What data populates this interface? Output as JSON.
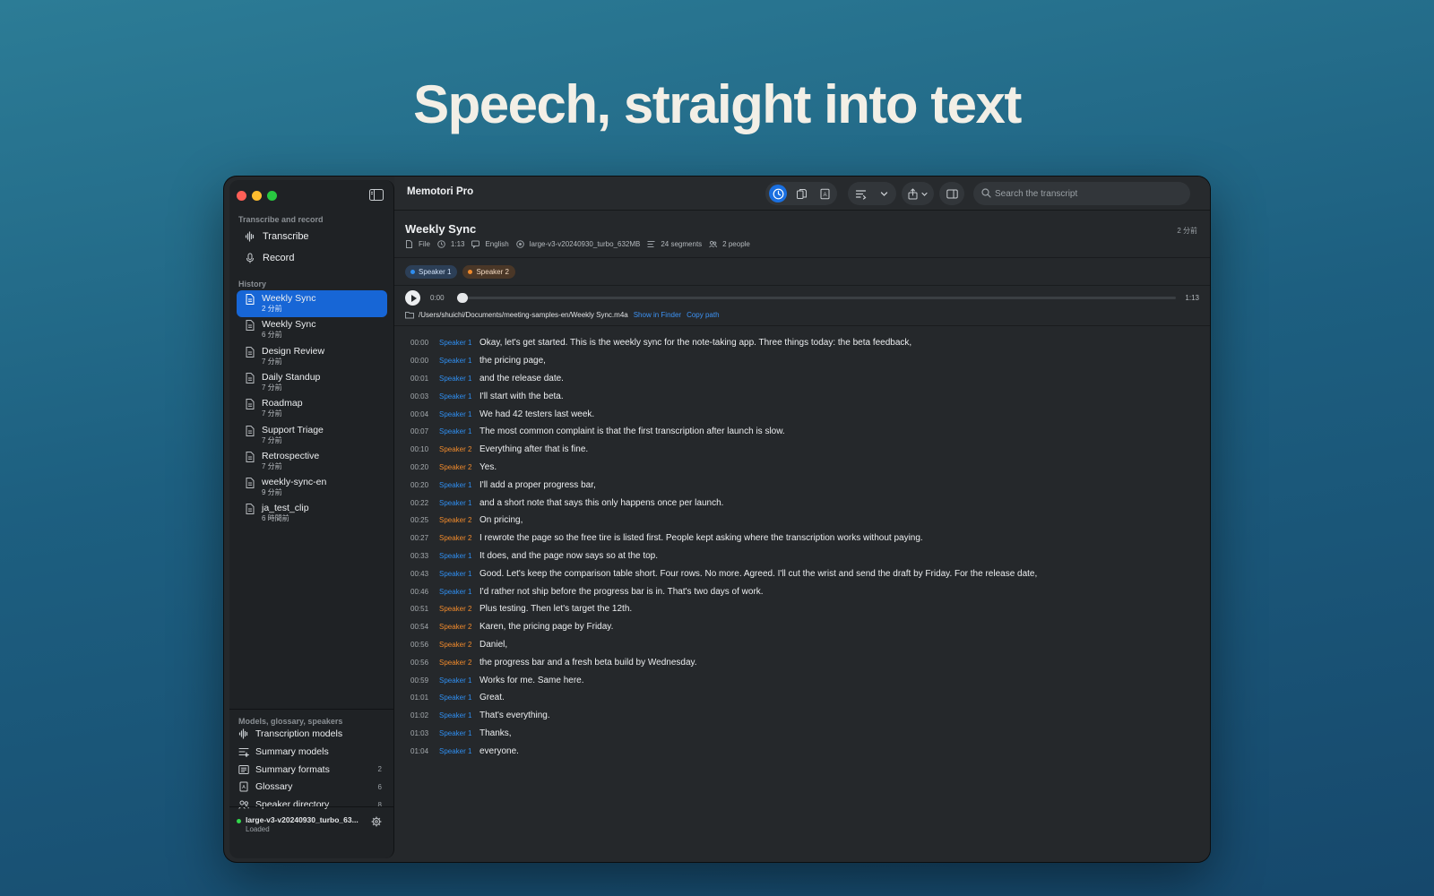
{
  "hero_title": "Speech, straight into text",
  "colors": {
    "accent": "#1766d6",
    "speaker1": "#2f8ef0",
    "speaker2": "#f08a2c",
    "status_loaded": "#32d74b"
  },
  "sidebar": {
    "section_transcribe": "Transcribe and record",
    "nav": [
      {
        "label": "Transcribe",
        "icon": "waveform-icon"
      },
      {
        "label": "Record",
        "icon": "microphone-icon"
      }
    ],
    "section_history": "History",
    "history": [
      {
        "title": "Weekly Sync",
        "time": "2 分前",
        "active": true
      },
      {
        "title": "Weekly Sync",
        "time": "6 分前"
      },
      {
        "title": "Design Review",
        "time": "7 分前"
      },
      {
        "title": "Daily Standup",
        "time": "7 分前"
      },
      {
        "title": "Roadmap",
        "time": "7 分前"
      },
      {
        "title": "Support Triage",
        "time": "7 分前"
      },
      {
        "title": "Retrospective",
        "time": "7 分前"
      },
      {
        "title": "weekly-sync-en",
        "time": "9 分前"
      },
      {
        "title": "ja_test_clip",
        "time": "6 時間前"
      }
    ],
    "section_models": "Models, glossary, speakers",
    "bottom": [
      {
        "label": "Transcription models",
        "count": "",
        "icon": "waveform-icon"
      },
      {
        "label": "Summary models",
        "count": "",
        "icon": "list-sparkle-icon"
      },
      {
        "label": "Summary formats",
        "count": "2",
        "icon": "list-box-icon"
      },
      {
        "label": "Glossary",
        "count": "6",
        "icon": "book-icon"
      },
      {
        "label": "Speaker directory",
        "count": "8",
        "icon": "people-icon"
      }
    ],
    "model_status": {
      "name": "large-v3-v20240930_turbo_63...",
      "state": "Loaded"
    }
  },
  "toolbar": {
    "app_title": "Memotori Pro",
    "search_placeholder": "Search the transcript"
  },
  "recording": {
    "title": "Weekly Sync",
    "age": "2 分前",
    "meta": {
      "source": "File",
      "duration": "1:13",
      "language": "English",
      "model": "large-v3-v20240930_turbo_632MB",
      "segments": "24 segments",
      "people": "2 people"
    },
    "speakers": [
      "Speaker 1",
      "Speaker 2"
    ],
    "player": {
      "current": "0:00",
      "total": "1:13",
      "progress": 0.0
    },
    "path": "/Users/shuichi/Documents/meeting-samples-en/Weekly Sync.m4a",
    "show_in_finder": "Show in Finder",
    "copy_path": "Copy path"
  },
  "segments": [
    {
      "t": "00:00",
      "s": "Speaker 1",
      "text": "Okay, let's get started. This is the weekly sync for the note-taking app. Three things today: the beta feedback,"
    },
    {
      "t": "00:00",
      "s": "Speaker 1",
      "text": "the pricing page,"
    },
    {
      "t": "00:01",
      "s": "Speaker 1",
      "text": "and the release date."
    },
    {
      "t": "00:03",
      "s": "Speaker 1",
      "text": "I'll start with the beta."
    },
    {
      "t": "00:04",
      "s": "Speaker 1",
      "text": "We had 42 testers last week."
    },
    {
      "t": "00:07",
      "s": "Speaker 1",
      "text": "The most common complaint is that the first transcription after launch is slow."
    },
    {
      "t": "00:10",
      "s": "Speaker 2",
      "text": "Everything after that is fine."
    },
    {
      "t": "00:20",
      "s": "Speaker 2",
      "text": "Yes."
    },
    {
      "t": "00:20",
      "s": "Speaker 1",
      "text": "I'll add a proper progress bar,"
    },
    {
      "t": "00:22",
      "s": "Speaker 1",
      "text": "and a short note that says this only happens once per launch."
    },
    {
      "t": "00:25",
      "s": "Speaker 2",
      "text": "On pricing,"
    },
    {
      "t": "00:27",
      "s": "Speaker 2",
      "text": "I rewrote the page so the free tire is listed first. People kept asking where the transcription works without paying."
    },
    {
      "t": "00:33",
      "s": "Speaker 1",
      "text": "It does, and the page now says so at the top."
    },
    {
      "t": "00:43",
      "s": "Speaker 1",
      "text": "Good. Let's keep the comparison table short. Four rows. No more. Agreed. I'll cut the wrist and send the draft by Friday. For the release date,"
    },
    {
      "t": "00:46",
      "s": "Speaker 1",
      "text": "I'd rather not ship before the progress bar is in. That's two days of work."
    },
    {
      "t": "00:51",
      "s": "Speaker 2",
      "text": "Plus testing. Then let's target the 12th."
    },
    {
      "t": "00:54",
      "s": "Speaker 2",
      "text": "Karen, the pricing page by Friday."
    },
    {
      "t": "00:56",
      "s": "Speaker 2",
      "text": "Daniel,"
    },
    {
      "t": "00:56",
      "s": "Speaker 2",
      "text": "the progress bar and a fresh beta build by Wednesday."
    },
    {
      "t": "00:59",
      "s": "Speaker 1",
      "text": "Works for me. Same here."
    },
    {
      "t": "01:01",
      "s": "Speaker 1",
      "text": "Great."
    },
    {
      "t": "01:02",
      "s": "Speaker 1",
      "text": "That's everything."
    },
    {
      "t": "01:03",
      "s": "Speaker 1",
      "text": "Thanks,"
    },
    {
      "t": "01:04",
      "s": "Speaker 1",
      "text": "everyone."
    }
  ]
}
